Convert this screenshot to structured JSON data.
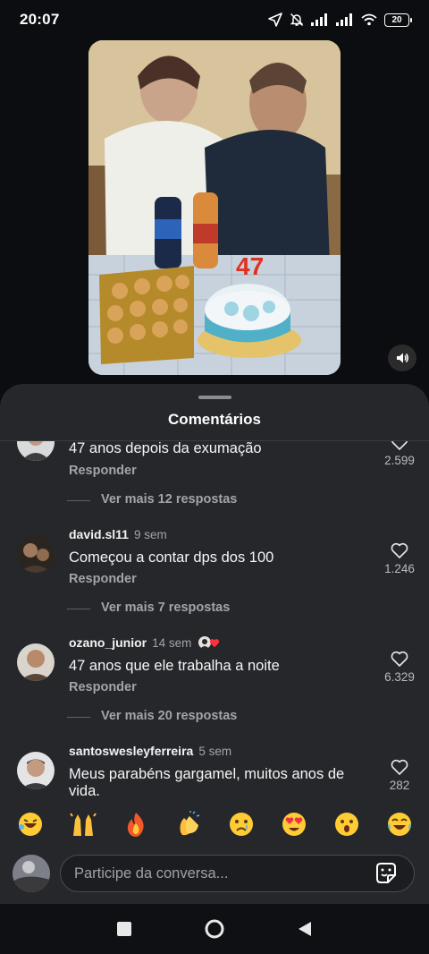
{
  "status": {
    "time": "20:07",
    "battery": "20"
  },
  "sheet": {
    "title": "Comentários"
  },
  "comments": [
    {
      "username": "",
      "time": "",
      "text": "47 anos depois da exumação",
      "reply": "Responder",
      "likes": "2.599",
      "more": "Ver mais 12 respostas"
    },
    {
      "username": "david.sl11",
      "time": "9 sem",
      "text": "Começou a contar dps dos 100",
      "reply": "Responder",
      "likes": "1.246",
      "more": "Ver mais 7 respostas"
    },
    {
      "username": "ozano_junior",
      "time": "14 sem",
      "text": "47 anos que ele trabalha a noite",
      "reply": "Responder",
      "likes": "6.329",
      "more": "Ver mais 20 respostas"
    },
    {
      "username": "santoswesleyferreira",
      "time": "5 sem",
      "text": "Meus parabéns gargamel, muitos anos de vida.",
      "likes": "282"
    }
  ],
  "emojis": [
    {
      "name": "rolling-laughing-emoji",
      "char": "🤣"
    },
    {
      "name": "raising-hands-emoji",
      "char": "🙌"
    },
    {
      "name": "fire-emoji",
      "char": "🔥"
    },
    {
      "name": "clapping-emoji",
      "char": "👏"
    },
    {
      "name": "crying-emoji",
      "char": "😢"
    },
    {
      "name": "heart-eyes-emoji",
      "char": "😍"
    },
    {
      "name": "surprised-emoji",
      "char": "😮"
    },
    {
      "name": "tears-of-joy-emoji",
      "char": "😂"
    }
  ],
  "composer": {
    "placeholder": "Participe da conversa..."
  },
  "colors": {
    "sheet_bg": "#25272b",
    "accent_like": "#ffffff",
    "badge_heart": "#ff3040"
  },
  "icons": [
    "location-arrow-icon",
    "bell-off-icon",
    "signal-icon",
    "wifi-icon",
    "battery-icon",
    "volume-icon",
    "heart-outline-icon",
    "sticker-icon",
    "square-icon",
    "circle-icon",
    "back-triangle-icon"
  ]
}
